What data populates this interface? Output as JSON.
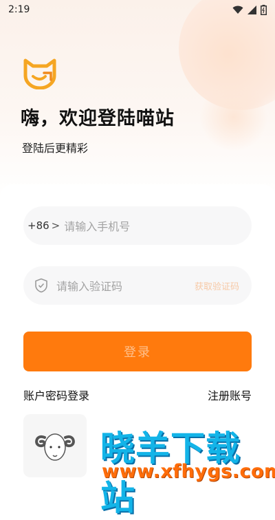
{
  "status_bar": {
    "time": "2:19",
    "icons": [
      "settings-dot-icon",
      "wifi-icon",
      "signal-icon",
      "battery-icon"
    ]
  },
  "header": {
    "logo_icon": "cat-logo-icon",
    "welcome_title": "嗨，欢迎登陆喵站",
    "subtitle": "登陆后更精彩"
  },
  "form": {
    "country_code": "+86",
    "phone_placeholder": "请输入手机号",
    "code_placeholder": "请输入验证码",
    "get_code_label": "获取验证码",
    "login_label": "登录"
  },
  "links": {
    "password_login": "账户密码登录",
    "register": "注册账号"
  },
  "watermark": {
    "title": "晓羊下载站",
    "url": "www.xfhygs.com"
  },
  "colors": {
    "accent": "#ff7a0d",
    "watermark_blue": "#13b4e8",
    "watermark_orange": "#ff6d0a"
  }
}
